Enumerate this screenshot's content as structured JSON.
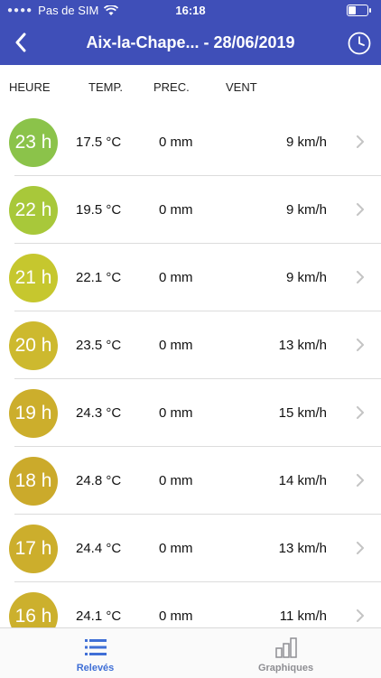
{
  "status_bar": {
    "carrier": "Pas de SIM",
    "time": "16:18",
    "battery_level": 0.45
  },
  "nav": {
    "title": "Aix-la-Chape... - 28/06/2019"
  },
  "columns": {
    "hour": "HEURE",
    "temp": "TEMP.",
    "prec": "PREC.",
    "wind": "VENT"
  },
  "rows": [
    {
      "hour": "23 h",
      "temp": "17.5 °C",
      "prec": "0 mm",
      "wind": "9 km/h",
      "color": "#8bc34a"
    },
    {
      "hour": "22 h",
      "temp": "19.5 °C",
      "prec": "0 mm",
      "wind": "9 km/h",
      "color": "#a8c83a"
    },
    {
      "hour": "21 h",
      "temp": "22.1 °C",
      "prec": "0 mm",
      "wind": "9 km/h",
      "color": "#c6c72e"
    },
    {
      "hour": "20 h",
      "temp": "23.5 °C",
      "prec": "0 mm",
      "wind": "13 km/h",
      "color": "#cdb92e"
    },
    {
      "hour": "19 h",
      "temp": "24.3 °C",
      "prec": "0 mm",
      "wind": "15 km/h",
      "color": "#ccae2c"
    },
    {
      "hour": "18 h",
      "temp": "24.8 °C",
      "prec": "0 mm",
      "wind": "14 km/h",
      "color": "#cbaa2b"
    },
    {
      "hour": "17 h",
      "temp": "24.4 °C",
      "prec": "0 mm",
      "wind": "13 km/h",
      "color": "#ccae2c"
    },
    {
      "hour": "16 h",
      "temp": "24.1 °C",
      "prec": "0 mm",
      "wind": "11 km/h",
      "color": "#ccb02d"
    }
  ],
  "tabs": [
    {
      "label": "Relevés",
      "icon": "list-icon",
      "active": true
    },
    {
      "label": "Graphiques",
      "icon": "bar-chart-icon",
      "active": false
    }
  ],
  "colors": {
    "nav_background": "#3f4fb8",
    "active_tab": "#3f6fd6",
    "inactive_tab": "#8e8e93"
  }
}
